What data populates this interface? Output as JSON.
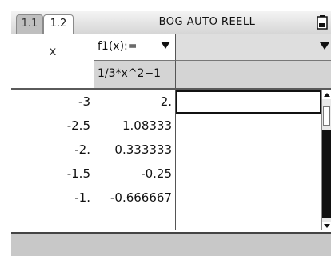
{
  "tabs": [
    {
      "label": "1.1",
      "active": false
    },
    {
      "label": "1.2",
      "active": true
    }
  ],
  "status": {
    "mode_label": "BOG AUTO REELL",
    "battery_icon": "battery-icon"
  },
  "columns": [
    {
      "name": "x",
      "formula": ""
    },
    {
      "name": "f1(x):=",
      "formula": "1/3*x^2−1"
    },
    {
      "name": "",
      "formula": ""
    }
  ],
  "rows": [
    {
      "x": "-3",
      "f1": "2."
    },
    {
      "x": "-2.5",
      "f1": "1.08333"
    },
    {
      "x": "-2.",
      "f1": "0.333333"
    },
    {
      "x": "-1.5",
      "f1": "-0.25"
    },
    {
      "x": "-1.",
      "f1": "-0.666667"
    },
    {
      "x": "",
      "f1": ""
    }
  ],
  "entry_line": {
    "value": ""
  },
  "colors": {
    "header_gray": "#d4d4d4",
    "grid_line": "#555555",
    "entry_bg": "#c8c8c8"
  }
}
